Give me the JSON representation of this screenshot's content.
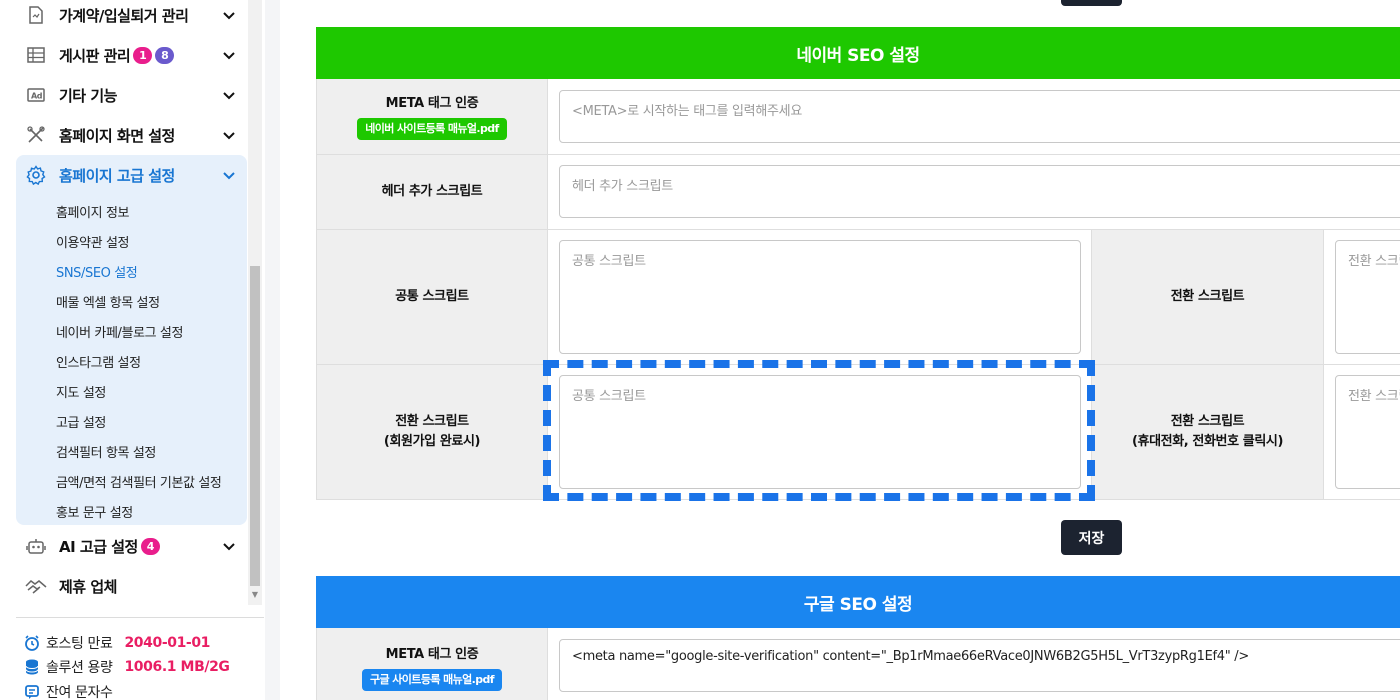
{
  "sidebar": {
    "items": [
      {
        "label": "가계약/입실퇴거 관리",
        "icon": "document-icon"
      },
      {
        "label": "게시판 관리",
        "icon": "table-icon",
        "badges": [
          "1",
          "8"
        ]
      },
      {
        "label": "기타 기능",
        "icon": "ad-icon"
      },
      {
        "label": "홈페이지 화면 설정",
        "icon": "tools-icon"
      },
      {
        "label": "홈페이지 고급 설정",
        "icon": "gear-icon"
      },
      {
        "label": "AI 고급 설정",
        "icon": "robot-icon",
        "badges": [
          "4"
        ]
      },
      {
        "label": "제휴 업체",
        "icon": "handshake-icon"
      }
    ],
    "subitems": [
      "홈페이지 정보",
      "이용약관 설정",
      "SNS/SEO 설정",
      "매물 엑셀 항목 설정",
      "네이버 카페/블로그 설정",
      "인스타그램 설정",
      "지도 설정",
      "고급 설정",
      "검색필터 항목 설정",
      "금액/면적 검색필터 기본값 설정",
      "홍보 문구 설정"
    ],
    "active_subitem": "SNS/SEO 설정",
    "stats": [
      {
        "label": "호스팅 만료",
        "value": "2040-01-01",
        "icon": "alarm-icon"
      },
      {
        "label": "솔루션 용량",
        "value": "1006.1 MB/2G",
        "icon": "database-icon"
      },
      {
        "label": "잔여 문자수",
        "value": "",
        "icon": "message-icon"
      }
    ]
  },
  "naver": {
    "title": "네이버 SEO 설정",
    "meta_label": "META 태그 인증",
    "meta_pdf": "네이버 사이트등록 매뉴얼.pdf",
    "meta_placeholder": "<META>로 시작하는 태그를 입력해주세요",
    "header_label": "헤더 추가 스크립트",
    "header_placeholder": "헤더 추가 스크립트",
    "common_label": "공통 스크립트",
    "common_placeholder": "공통 스크립트",
    "conversion_label": "전환 스크립트",
    "conversion_placeholder": "전환 스크립트",
    "signup_label_1": "전환 스크립트",
    "signup_label_2": "(회원가입 완료시)",
    "signup_placeholder": "공통 스크립트",
    "call_label_1": "전환 스크립트",
    "call_label_2": "(휴대전화, 전화번호 클릭시)",
    "call_placeholder": "전환 스크립트",
    "save": "저장"
  },
  "google": {
    "title": "구글 SEO 설정",
    "meta_label": "META 태그 인증",
    "meta_pdf": "구글 사이트등록 매뉴얼.pdf",
    "meta_value": "<meta name=\"google-site-verification\" content=\"_Bp1rMmae66eRVace0JNW6B2G5H5L_VrT3zypRg1Ef4\" />"
  },
  "colors": {
    "naver_green": "#1ec800",
    "google_blue": "#1a86f0",
    "active_blue": "#1976d2",
    "badge_pink": "#e91e8c",
    "badge_purple": "#6a5acd",
    "highlight": "#1a73e8"
  }
}
